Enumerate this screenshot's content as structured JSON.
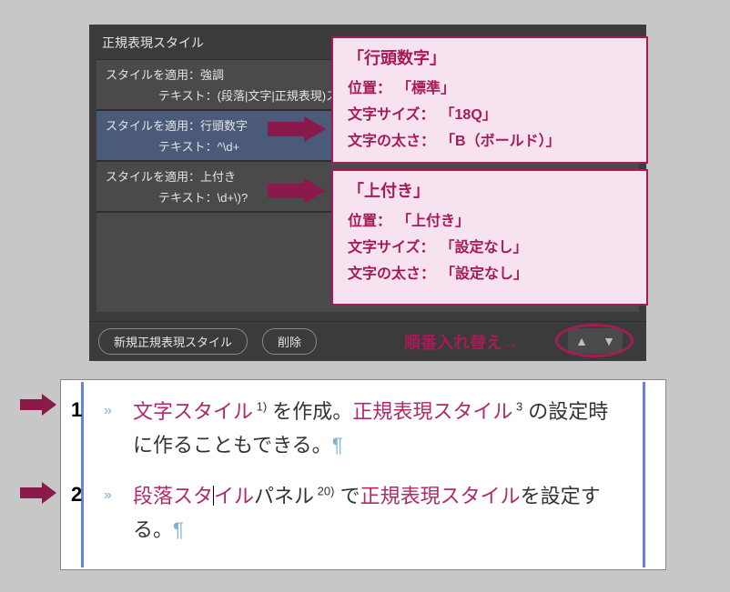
{
  "panel": {
    "title": "正規表現スタイル",
    "rows": [
      {
        "apply_label": "スタイルを適用：",
        "apply_value": "強調",
        "text_label": "テキスト：",
        "text_value": "(段落|文字|正規表現)スタ"
      },
      {
        "apply_label": "スタイルを適用：",
        "apply_value": "行頭数字",
        "text_label": "テキスト：",
        "text_value": "^\\d+"
      },
      {
        "apply_label": "スタイルを適用：",
        "apply_value": "上付き",
        "text_label": "テキスト：",
        "text_value": "\\d+\\)?"
      }
    ],
    "footer": {
      "new_button": "新規正規表現スタイル",
      "delete_button": "削除",
      "reorder_label": "順番入れ替え→"
    }
  },
  "callouts": [
    {
      "title": "「行頭数字」",
      "lines": [
        {
          "key": "位置：",
          "val": "「標準」"
        },
        {
          "key": "文字サイズ：",
          "val": "「18Q」"
        },
        {
          "key": "文字の太さ：",
          "val": "「B（ボールド）」"
        }
      ]
    },
    {
      "title": "「上付き」",
      "lines": [
        {
          "key": "位置：",
          "val": "「上付き」"
        },
        {
          "key": "文字サイズ：",
          "val": "「設定なし」"
        },
        {
          "key": "文字の太さ：",
          "val": "「設定なし」"
        }
      ]
    }
  ],
  "editor": {
    "paras": [
      {
        "num": "1",
        "segments": [
          {
            "t": "文字スタイル",
            "pink": true
          },
          {
            "t": " 1)",
            "sup": true
          },
          {
            "t": " を作成。"
          },
          {
            "t": "正規表現スタイル",
            "pink": true
          },
          {
            "t": " 3",
            "sup": true
          },
          {
            "t": " の設定時に作ることもできる。"
          }
        ]
      },
      {
        "num": "2",
        "segments": [
          {
            "t": "段落スタ",
            "pink": true
          },
          {
            "t": "",
            "cursor": true
          },
          {
            "t": "イル",
            "pink": true
          },
          {
            "t": "パネル"
          },
          {
            "t": " 20)",
            "sup": true
          },
          {
            "t": " で"
          },
          {
            "t": "正規表現スタイル",
            "pink": true
          },
          {
            "t": "を設定する。"
          }
        ]
      }
    ]
  }
}
